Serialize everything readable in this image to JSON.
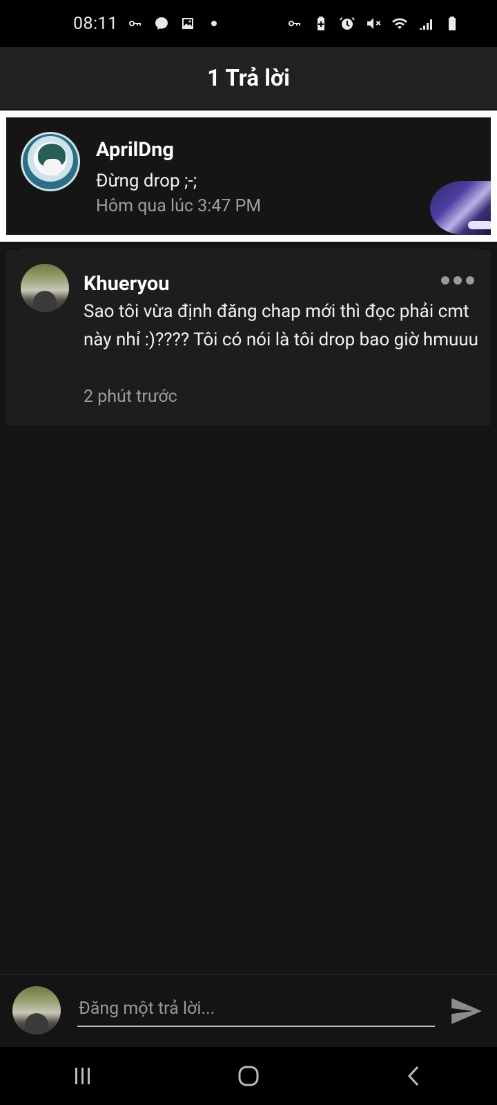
{
  "status_bar": {
    "time": "08:11",
    "left_icons": [
      "key-icon",
      "messenger-icon",
      "image-icon",
      "dot-icon"
    ],
    "right_icons": [
      "vpn-key-icon",
      "battery-saver-icon",
      "alarm-icon",
      "mute-icon",
      "wifi-icon",
      "signal-icon",
      "battery-icon"
    ]
  },
  "header": {
    "title": "1 Trả lời"
  },
  "parent_comment": {
    "author": "AprilDng",
    "text": "Đừng drop ;-;",
    "time": "Hôm qua lúc 3:47 PM"
  },
  "reply": {
    "author": "Khueryou",
    "text": "Sao tôi vừa định đăng chap mới thì đọc phải cmt này nhỉ :)????  Tôi có nói là tôi drop bao giờ hmuuu",
    "time": "2 phút trước"
  },
  "compose": {
    "placeholder": "Đăng một trả lời..."
  },
  "colors": {
    "background": "#141414",
    "appbar": "#212121",
    "card": "#1d1d1d",
    "secondary_text": "#9e9e9e"
  }
}
